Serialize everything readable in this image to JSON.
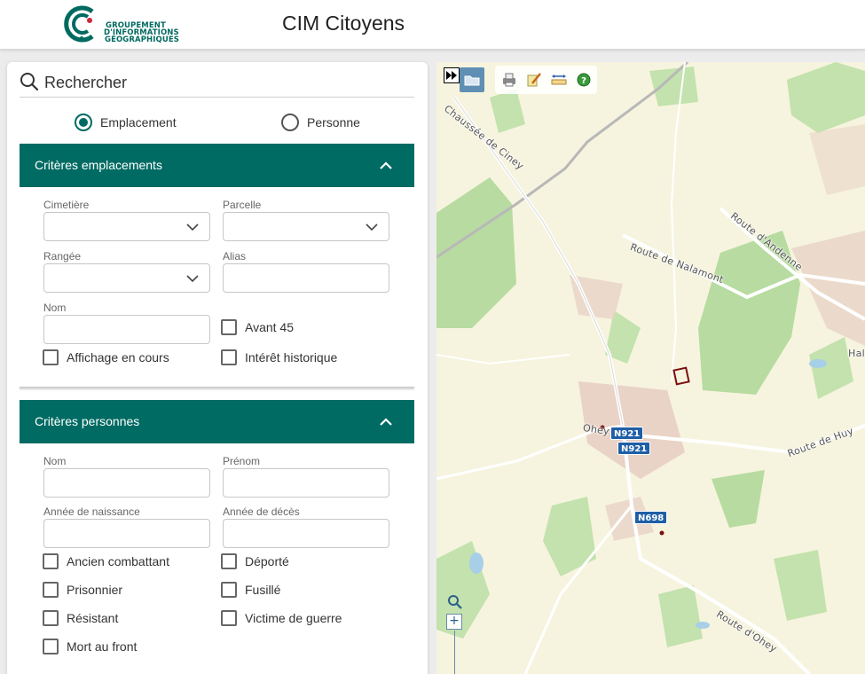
{
  "header": {
    "logo_lines": [
      "GROUPEMENT",
      "D'INFORMATIONS",
      "GÉOGRAPHIQUES"
    ],
    "title": "CIM Citoyens",
    "logo_colors": {
      "teal": "#006a60",
      "red": "#d5263b"
    }
  },
  "search": {
    "label": "Rechercher",
    "mode_options": [
      {
        "label": "Emplacement",
        "checked": true
      },
      {
        "label": "Personne",
        "checked": false
      }
    ]
  },
  "emplacements": {
    "title": "Critères emplacements",
    "fields": {
      "cimetiere": {
        "label": "Cimetière",
        "value": ""
      },
      "parcelle": {
        "label": "Parcelle",
        "value": ""
      },
      "rangee": {
        "label": "Rangée",
        "value": ""
      },
      "alias": {
        "label": "Alias",
        "value": ""
      },
      "nom": {
        "label": "Nom",
        "value": ""
      }
    },
    "checks": {
      "avant45": {
        "label": "Avant 45",
        "checked": false
      },
      "affichage": {
        "label": "Affichage en cours",
        "checked": false
      },
      "interet": {
        "label": "Intérêt historique",
        "checked": false
      }
    }
  },
  "personnes": {
    "title": "Critères personnes",
    "fields": {
      "nom": {
        "label": "Nom",
        "value": ""
      },
      "prenom": {
        "label": "Prénom",
        "value": ""
      },
      "naissance": {
        "label": "Année de naissance",
        "value": ""
      },
      "deces": {
        "label": "Année de décès",
        "value": ""
      }
    },
    "checks": {
      "ancien_combattant": {
        "label": "Ancien combattant",
        "checked": false
      },
      "deporte": {
        "label": "Déporté",
        "checked": false
      },
      "prisonnier": {
        "label": "Prisonnier",
        "checked": false
      },
      "fusille": {
        "label": "Fusillé",
        "checked": false
      },
      "resistant": {
        "label": "Résistant",
        "checked": false
      },
      "victime": {
        "label": "Victime de guerre",
        "checked": false
      },
      "mort_front": {
        "label": "Mort au front",
        "checked": false
      }
    }
  },
  "map": {
    "labels": {
      "chaussee": "Chaussée de Ciney",
      "andenne": "Route d'Andenne",
      "nalamont": "Route de Nalamont",
      "huy": "Route de Huy",
      "ohey_route": "Route d'Ohey",
      "ohey_town": "Ohey",
      "edge": "Hal"
    },
    "shields": {
      "n921a": "N921",
      "n921b": "N921",
      "n698": "N698"
    },
    "tools": [
      "expand-icon",
      "open-folder-icon",
      "print-icon",
      "edit-icon",
      "measure-icon",
      "help-icon"
    ]
  }
}
